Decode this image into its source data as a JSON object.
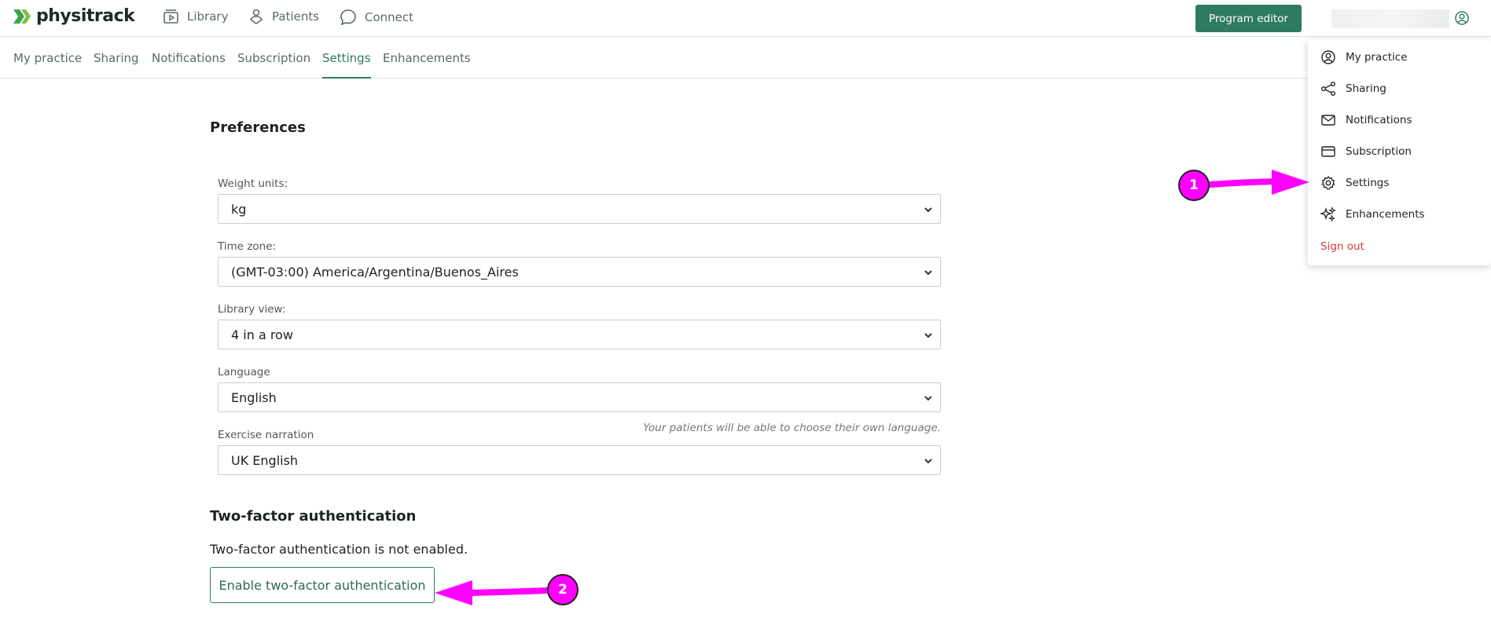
{
  "header": {
    "logo_text": "physitrack",
    "nav": [
      {
        "label": "Library",
        "icon": "library-icon"
      },
      {
        "label": "Patients",
        "icon": "patients-icon"
      },
      {
        "label": "Connect",
        "icon": "chat-icon"
      }
    ],
    "program_editor_label": "Program editor"
  },
  "subnav": {
    "tabs": [
      {
        "label": "My practice"
      },
      {
        "label": "Sharing"
      },
      {
        "label": "Notifications"
      },
      {
        "label": "Subscription"
      },
      {
        "label": "Settings",
        "active": true
      },
      {
        "label": "Enhancements"
      }
    ]
  },
  "preferences": {
    "title": "Preferences",
    "weight": {
      "label": "Weight units:",
      "value": "kg"
    },
    "timezone": {
      "label": "Time zone:",
      "value": "(GMT-03:00) America/Argentina/Buenos_Aires"
    },
    "library_view": {
      "label": "Library view:",
      "value": "4 in a row"
    },
    "language": {
      "label": "Language",
      "value": "English",
      "hint": "Your patients will be able to choose their own language."
    },
    "narration": {
      "label": "Exercise narration",
      "value": "UK English"
    }
  },
  "two_factor": {
    "title": "Two-factor authentication",
    "status": "Two-factor authentication is not enabled.",
    "button_label": "Enable two-factor authentication"
  },
  "user_menu": {
    "items": [
      {
        "label": "My practice",
        "icon": "user-circle-icon"
      },
      {
        "label": "Sharing",
        "icon": "share-icon"
      },
      {
        "label": "Notifications",
        "icon": "mail-icon"
      },
      {
        "label": "Subscription",
        "icon": "credit-card-icon"
      },
      {
        "label": "Settings",
        "icon": "gear-icon"
      },
      {
        "label": "Enhancements",
        "icon": "sparkles-icon"
      }
    ],
    "sign_out": "Sign out"
  },
  "annotations": {
    "badge_1": "1",
    "badge_2": "2",
    "color": "#ff00ff"
  },
  "colors": {
    "brand": "#2f7a62",
    "danger": "#d33b3b"
  }
}
